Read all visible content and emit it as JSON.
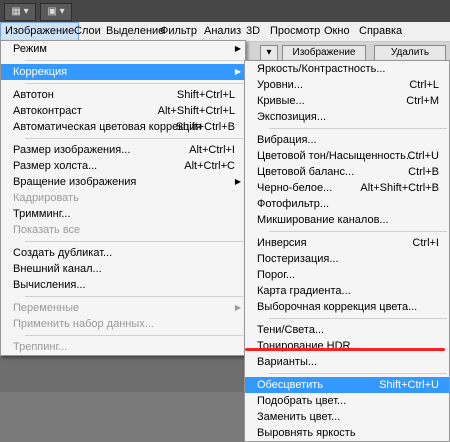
{
  "toolbar": {
    "btn1": "▦ ▾",
    "btn2": "▣ ▾"
  },
  "menubar": [
    "Изображение",
    "Слои",
    "Выделение",
    "Фильтр",
    "Анализ",
    "3D",
    "Просмотр",
    "Окно",
    "Справка"
  ],
  "optbar": {
    "b1": "▾",
    "b2": "Изображение",
    "b3": "Удалить"
  },
  "main_menu": {
    "items": [
      {
        "label": "Режим",
        "shortcut": "",
        "submenu": true,
        "disabled": false
      },
      {
        "sep": true
      },
      {
        "label": "Коррекция",
        "shortcut": "",
        "submenu": true,
        "disabled": false,
        "highlight": true
      },
      {
        "sep": true
      },
      {
        "label": "Автотон",
        "shortcut": "Shift+Ctrl+L"
      },
      {
        "label": "Автоконтраст",
        "shortcut": "Alt+Shift+Ctrl+L"
      },
      {
        "label": "Автоматическая цветовая коррекция",
        "shortcut": "Shift+Ctrl+B"
      },
      {
        "sep": true
      },
      {
        "label": "Размер изображения...",
        "shortcut": "Alt+Ctrl+I"
      },
      {
        "label": "Размер холста...",
        "shortcut": "Alt+Ctrl+C"
      },
      {
        "label": "Вращение изображения",
        "shortcut": "",
        "submenu": true
      },
      {
        "label": "Кадрировать",
        "shortcut": "",
        "disabled": true
      },
      {
        "label": "Тримминг...",
        "shortcut": ""
      },
      {
        "label": "Показать все",
        "shortcut": "",
        "disabled": true
      },
      {
        "sep": true
      },
      {
        "label": "Создать дубликат...",
        "shortcut": ""
      },
      {
        "label": "Внешний канал...",
        "shortcut": ""
      },
      {
        "label": "Вычисления...",
        "shortcut": ""
      },
      {
        "sep": true
      },
      {
        "label": "Переменные",
        "shortcut": "",
        "submenu": true,
        "disabled": true
      },
      {
        "label": "Применить набор данных...",
        "shortcut": "",
        "disabled": true
      },
      {
        "sep": true
      },
      {
        "label": "Треппинг...",
        "shortcut": "",
        "disabled": true
      }
    ]
  },
  "sub_menu": {
    "items": [
      {
        "label": "Яркость/Контрастность...",
        "shortcut": ""
      },
      {
        "label": "Уровни...",
        "shortcut": "Ctrl+L"
      },
      {
        "label": "Кривые...",
        "shortcut": "Ctrl+M"
      },
      {
        "label": "Экспозиция...",
        "shortcut": ""
      },
      {
        "sep": true
      },
      {
        "label": "Вибрация...",
        "shortcut": ""
      },
      {
        "label": "Цветовой тон/Насыщенность...",
        "shortcut": "Ctrl+U"
      },
      {
        "label": "Цветовой баланс...",
        "shortcut": "Ctrl+B"
      },
      {
        "label": "Черно-белое...",
        "shortcut": "Alt+Shift+Ctrl+B"
      },
      {
        "label": "Фотофильтр...",
        "shortcut": ""
      },
      {
        "label": "Микширование каналов...",
        "shortcut": ""
      },
      {
        "sep": true
      },
      {
        "label": "Инверсия",
        "shortcut": "Ctrl+I"
      },
      {
        "label": "Постеризация...",
        "shortcut": ""
      },
      {
        "label": "Порог...",
        "shortcut": ""
      },
      {
        "label": "Карта градиента...",
        "shortcut": ""
      },
      {
        "label": "Выборочная коррекция цвета...",
        "shortcut": ""
      },
      {
        "sep": true
      },
      {
        "label": "Тени/Света...",
        "shortcut": ""
      },
      {
        "label": "Тонирование HDR...",
        "shortcut": ""
      },
      {
        "label": "Варианты...",
        "shortcut": ""
      },
      {
        "sep": true
      },
      {
        "label": "Обесцветить",
        "shortcut": "Shift+Ctrl+U",
        "highlight": true
      },
      {
        "label": "Подобрать цвет...",
        "shortcut": ""
      },
      {
        "label": "Заменить цвет...",
        "shortcut": ""
      },
      {
        "label": "Выровнять яркость",
        "shortcut": ""
      }
    ]
  },
  "colors": {
    "highlight": "#3399ff",
    "menu_bg": "#f5f5f5",
    "annotation": "#ff2020"
  }
}
